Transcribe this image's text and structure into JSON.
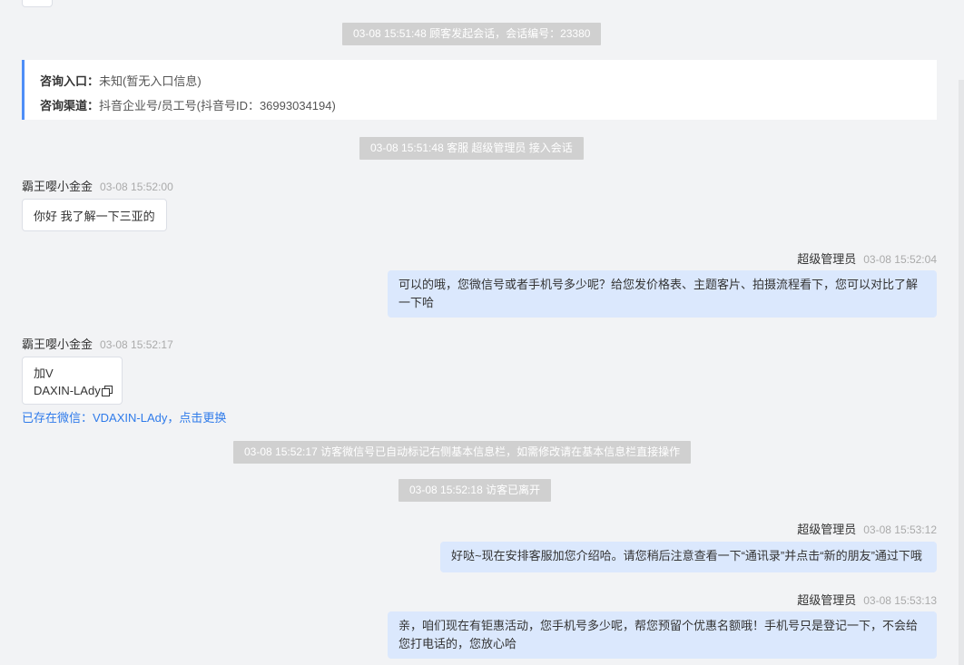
{
  "system_messages": {
    "session_start": "03-08 15:51:48 顾客发起会话，会话编号：23380",
    "agent_joined": "03-08 15:51:48 客服 超级管理员 接入会话",
    "wechat_marked": "03-08 15:52:17 访客微信号已自动标记右侧基本信息栏，如需修改请在基本信息栏直接操作",
    "visitor_left": "03-08 15:52:18 访客已离开"
  },
  "info_card": {
    "entry_label": "咨询入口：",
    "entry_value": "未知(暂无入口信息)",
    "channel_label": "咨询渠道：",
    "channel_value": "抖音企业号/员工号(抖音号ID：36993034194)"
  },
  "messages": [
    {
      "sender": "霸王嘤小金金",
      "time": "03-08 15:52:00",
      "text": "你好 我了解一下三亚的"
    },
    {
      "sender": "超级管理员",
      "time": "03-08 15:52:04",
      "line1": "可以的哦，您微信号或者手机号多少呢？给您发价格表、主题客片、拍摄流程看下，您可以对比了解",
      "line2": "一下哈"
    },
    {
      "sender": "霸王嘤小金金",
      "time": "03-08 15:52:17",
      "line1": "加V",
      "line2": "DAXIN-LAdy"
    },
    {
      "sender": "超级管理员",
      "time": "03-08 15:53:12",
      "text": "好哒~现在安排客服加您介绍哈。请您稍后注意查看一下“通讯录”并点击“新的朋友”通过下哦"
    },
    {
      "sender": "超级管理员",
      "time": "03-08 15:53:13",
      "line1": "亲，咱们现在有钜惠活动，您手机号多少呢，帮您预留个优惠名额哦！手机号只是登记一下，不会给",
      "line2": "您打电话的，您放心哈"
    }
  ],
  "wechat_link": "已存在微信：VDAXIN-LAdy，点击更换",
  "icons": {
    "copy": "copy-icon"
  }
}
